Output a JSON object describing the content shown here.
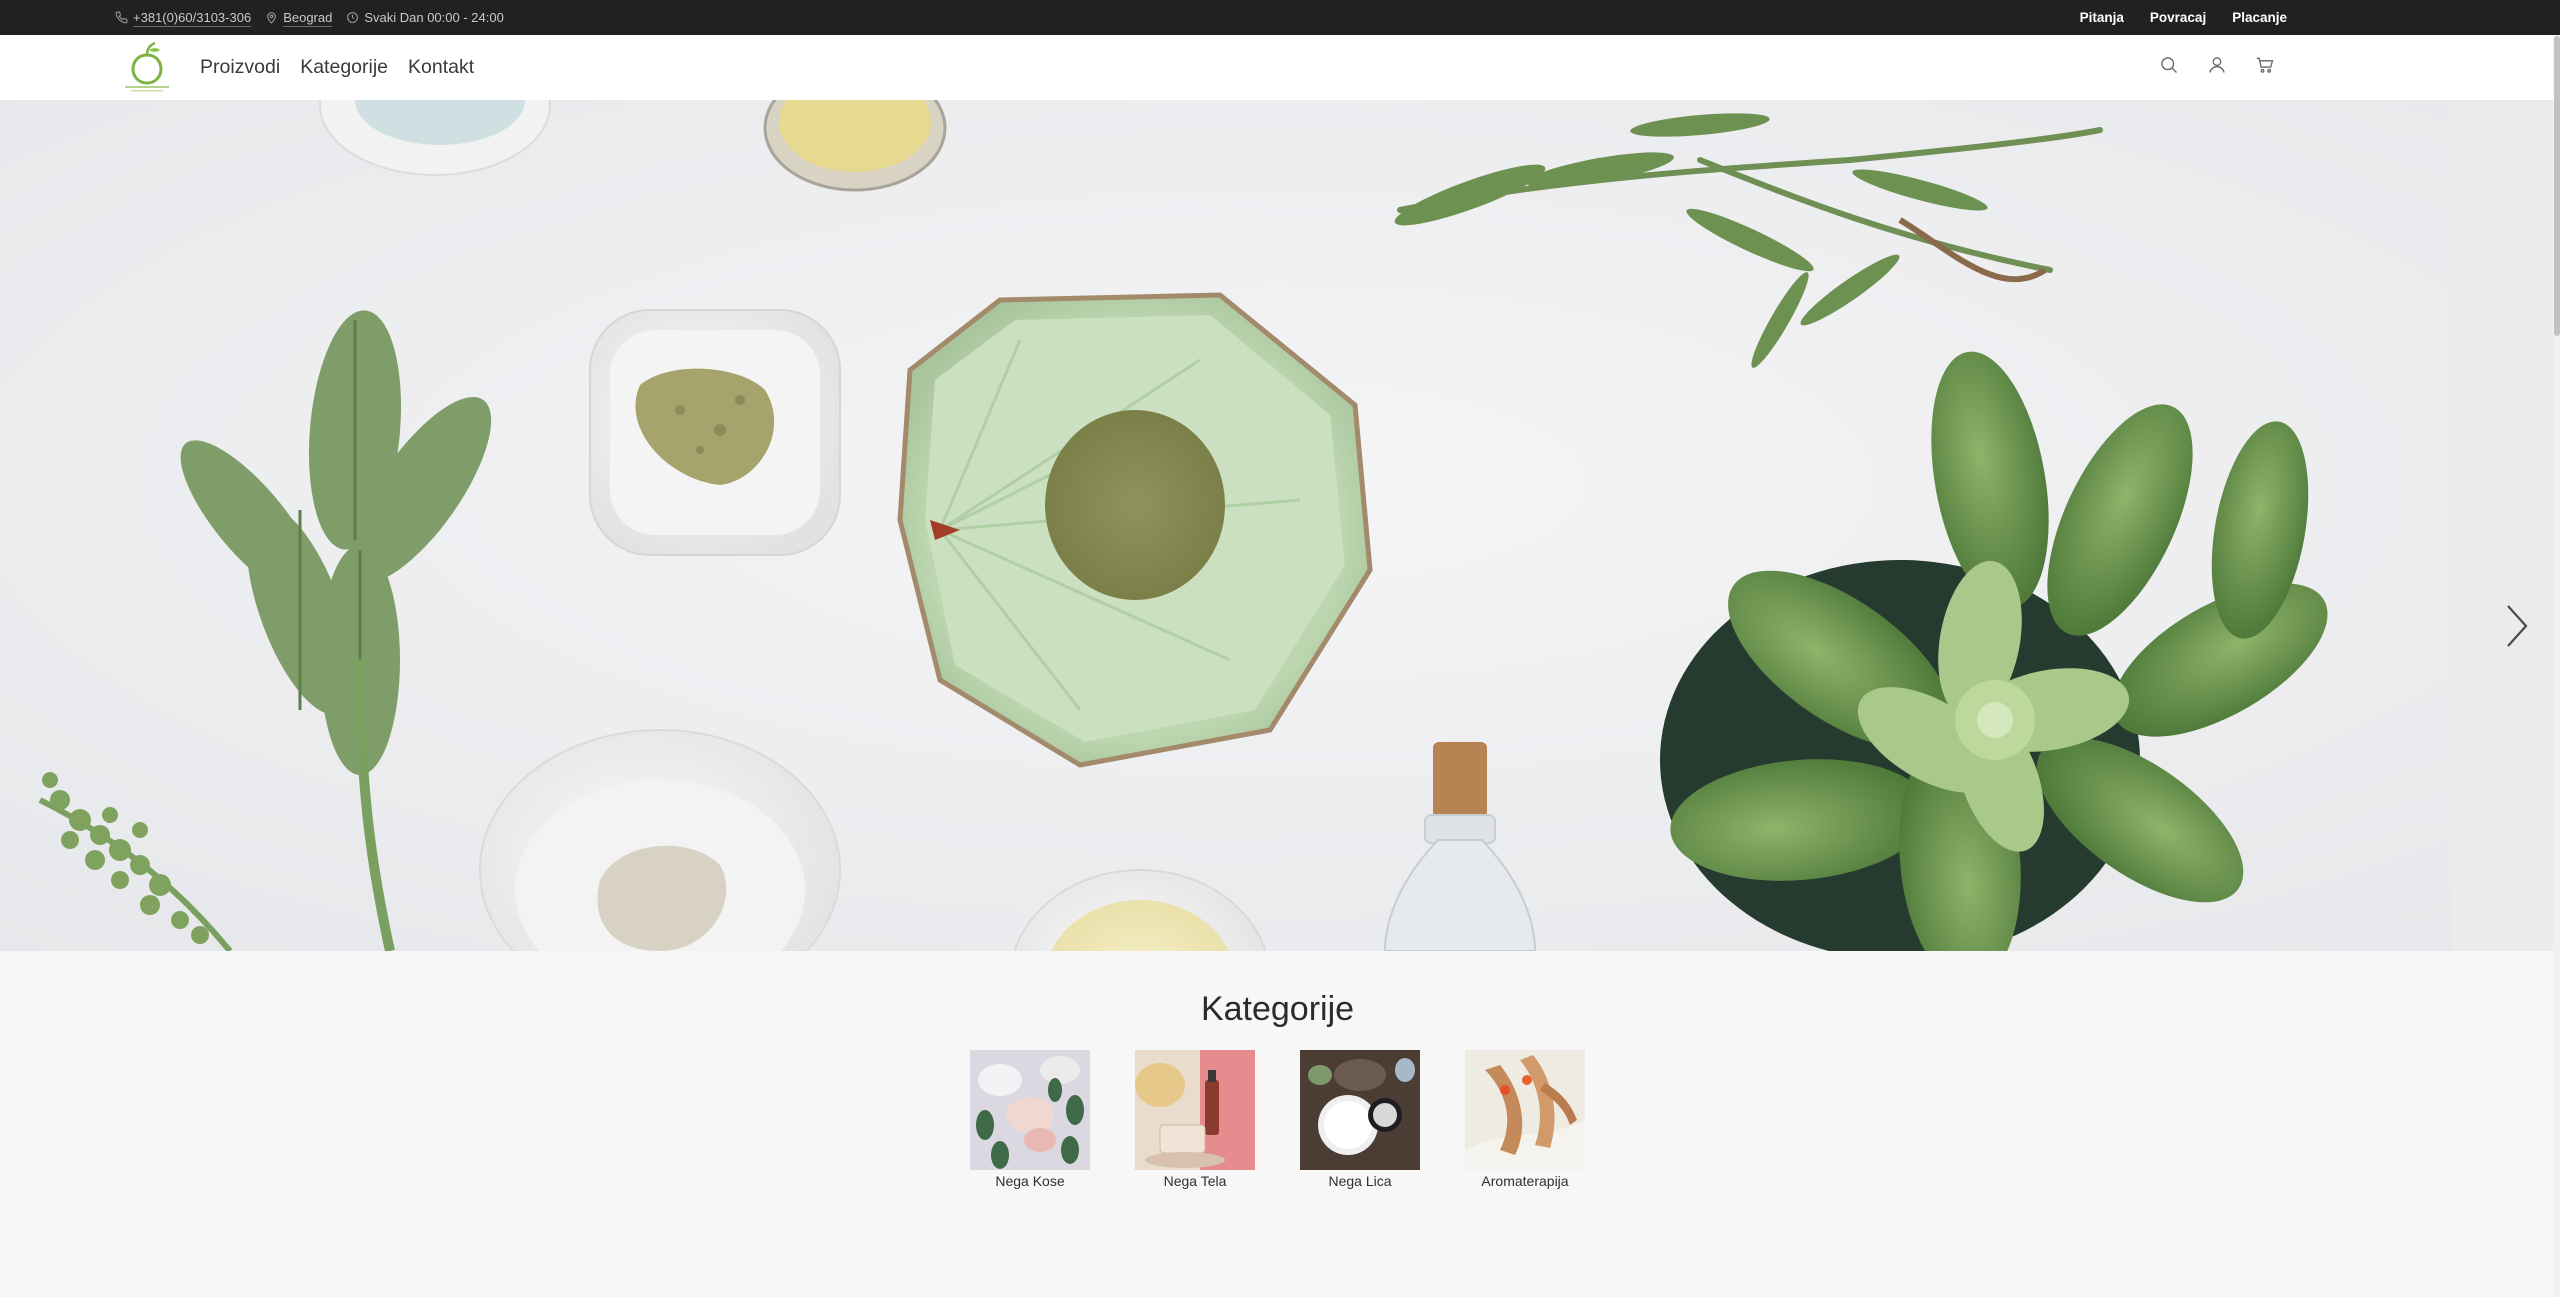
{
  "topbar": {
    "phone": "+381(0)60/3103-306",
    "city": "Beograd",
    "hours": "Svaki Dan 00:00 - 24:00",
    "links": [
      "Pitanja",
      "Povracaj",
      "Placanje"
    ]
  },
  "header": {
    "nav": [
      "Proizvodi",
      "Kategorije",
      "Kontakt"
    ],
    "icons": [
      "search-icon",
      "user-icon",
      "cart-icon"
    ]
  },
  "hero": {
    "next_icon": "chevron-right-icon"
  },
  "categories": {
    "title": "Kategorije",
    "items": [
      {
        "label": "Nega Kose"
      },
      {
        "label": "Nega Tela"
      },
      {
        "label": "Nega Lica"
      },
      {
        "label": "Aromaterapija"
      }
    ]
  },
  "colors": {
    "topbar_bg": "#212121",
    "header_bg": "#ffffff",
    "page_bg": "#f7f7f7",
    "brand_green": "#7cb342"
  }
}
